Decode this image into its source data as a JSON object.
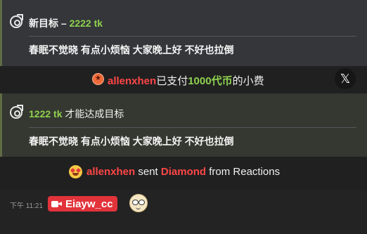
{
  "goal_card_1": {
    "prefix": "新目标 – ",
    "amount": "2222 tk",
    "message": "春眠不觉晓 有点小烦恼 大家晚上好 不好也拉倒"
  },
  "tip_banner": {
    "user": "allenxhen",
    "text_before": "已支付",
    "amount": "1000代币",
    "text_after": "的小费",
    "x_label": "𝕏"
  },
  "goal_card_2": {
    "amount": "1222 tk",
    "suffix": " 才能达成目标",
    "message": "春眠不觉晓 有点小烦恼 大家晚上好 不好也拉倒"
  },
  "diamond_banner": {
    "user": "allenxhen",
    "text_sent": " sent ",
    "gift": "Diamond",
    "text_from": " from Reactions"
  },
  "chat": {
    "timestamp": "下午 11:21",
    "username": "Eiayw_cc"
  },
  "icons": {
    "goal": "goal-target-icon",
    "coin": "coin-star-icon",
    "heart_eyes": "heart-eyes-emoji-icon",
    "camera": "camera-icon",
    "emote": "glasses-emote-icon"
  },
  "colors": {
    "accent_green": "#8fd14f",
    "user_red": "#ff4646",
    "badge_red": "#e2333b"
  }
}
